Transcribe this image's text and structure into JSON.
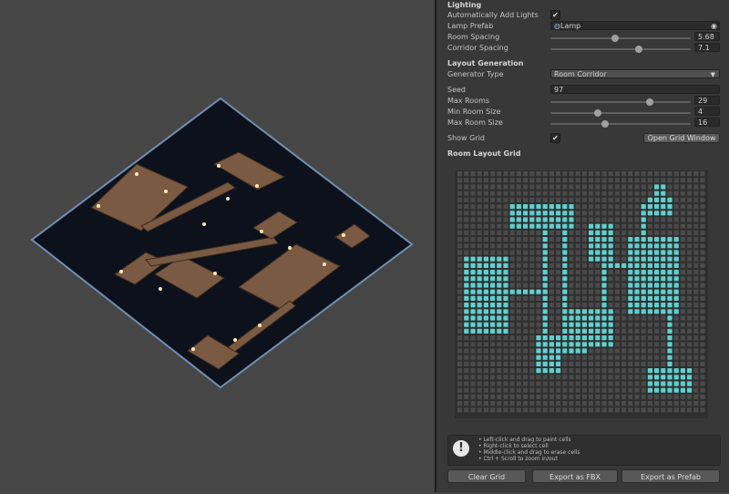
{
  "inspector": {
    "lighting": {
      "header": "Lighting",
      "auto_add_label": "Automatically Add Lights",
      "auto_add_checked": true,
      "lamp_label": "Lamp Prefab",
      "lamp_value": "Lamp",
      "room_spacing_label": "Room Spacing",
      "room_spacing_value": "5.68",
      "room_spacing_fraction": 0.46,
      "corridor_spacing_label": "Corridor Spacing",
      "corridor_spacing_value": "7.1",
      "corridor_spacing_fraction": 0.63
    },
    "layout": {
      "header": "Layout Generation",
      "generator_label": "Generator Type",
      "generator_value": "Room Corridor",
      "seed_label": "Seed",
      "seed_value": "97",
      "max_rooms_label": "Max Rooms",
      "max_rooms_value": "29",
      "max_rooms_fraction": 0.71,
      "min_room_label": "Min Room Size",
      "min_room_value": "4",
      "min_room_fraction": 0.34,
      "max_room_label": "Max Room Size",
      "max_room_value": "16",
      "max_room_fraction": 0.39,
      "show_grid_label": "Show Grid",
      "show_grid_checked": true,
      "open_grid_button": "Open Grid Window"
    },
    "grid": {
      "header": "Room Layout Grid",
      "cols": 38,
      "rows": 37,
      "fill_color": "#5fd0cf",
      "empty_color": "#4a4a4a"
    },
    "help": {
      "lines": [
        "• Left-click and drag to paint cells",
        "• Right-click to select cell",
        "• Middle-click and drag to erase cells",
        "• Ctrl + Scroll to zoom in/out"
      ]
    },
    "buttons": {
      "clear": "Clear Grid",
      "fbx": "Export as FBX",
      "prefab": "Export as Prefab"
    }
  },
  "colors": {
    "accent_teal": "#5fd0cf",
    "floor_outline": "#6f8fb3",
    "floor_fill": "#0c111b",
    "room_floor": "#7a5a42"
  }
}
